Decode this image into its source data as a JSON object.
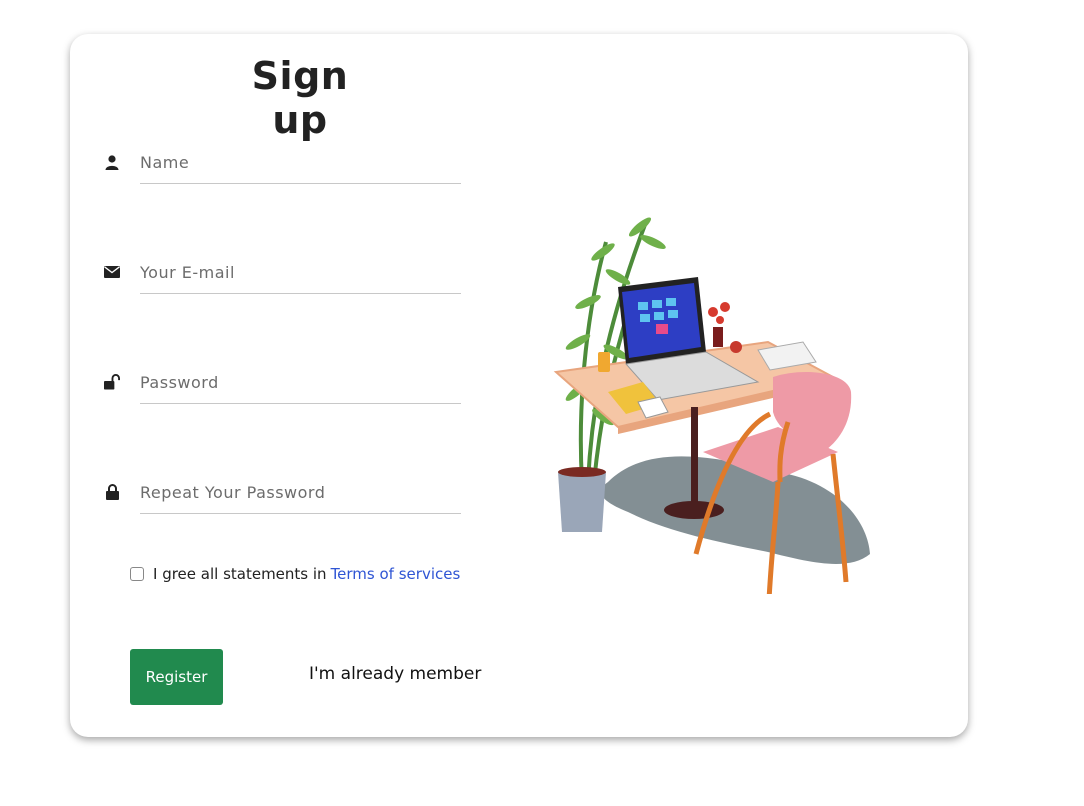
{
  "form": {
    "title": "Sign up",
    "fields": [
      {
        "name": "name",
        "placeholder": "Name",
        "value": "",
        "icon": "user-icon"
      },
      {
        "name": "email",
        "placeholder": "Your E-mail",
        "value": "",
        "icon": "envelope-icon"
      },
      {
        "name": "password",
        "placeholder": "Password",
        "value": "",
        "icon": "unlock-icon"
      },
      {
        "name": "repeat_password",
        "placeholder": "Repeat Your Password",
        "value": "",
        "icon": "lock-icon"
      }
    ],
    "agree_text": "I gree all statements in",
    "terms_link": "Terms of services",
    "agree_checked": false,
    "register_label": "Register",
    "member_link": "I'm already member"
  },
  "colors": {
    "register_button": "#218a4e",
    "link": "#2f55d4",
    "chair": "#ee9aa6",
    "desk": "#f5c6a5",
    "laptop_screen": "#2d3ec4"
  },
  "illustration": {
    "subject": "desk-with-laptop-chair-plant"
  }
}
